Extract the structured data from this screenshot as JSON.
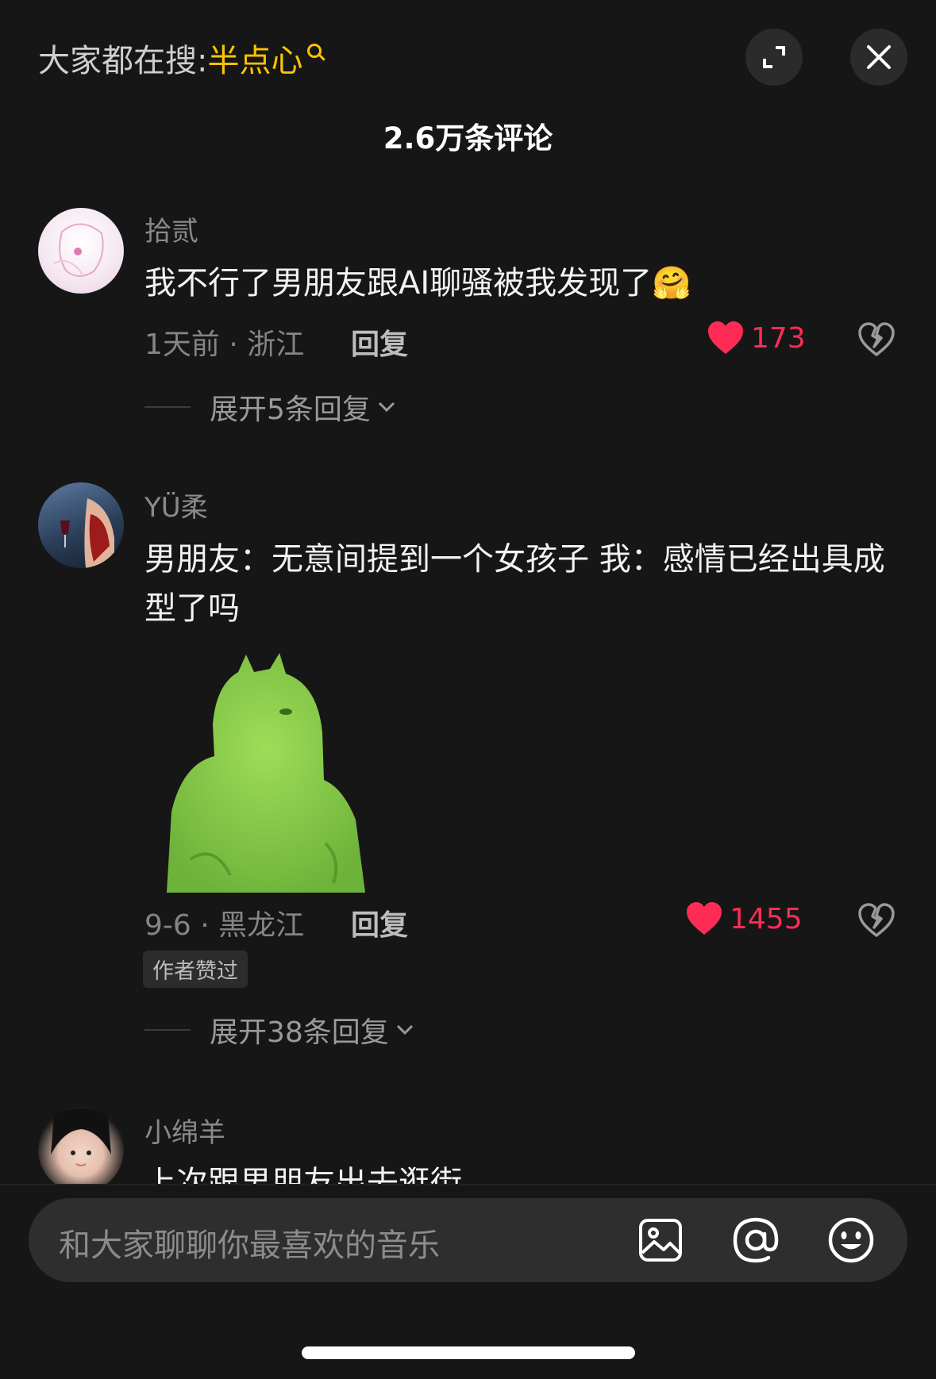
{
  "header": {
    "search_prefix": "大家都在搜:",
    "search_keyword": "半点心",
    "comment_count": "2.6万条评论"
  },
  "comments": [
    {
      "username": "拾贰",
      "text": "我不行了男朋友跟AI聊骚被我发现了🤗",
      "meta": "1天前 · 浙江",
      "reply_label": "回复",
      "likes": "173",
      "expand_label": "展开5条回复"
    },
    {
      "username": "YÜ柔",
      "text": "男朋友：无意间提到一个女孩子  我：感情已经出具成型了吗",
      "meta": "9-6 · 黑龙江",
      "reply_label": "回复",
      "likes": "1455",
      "badge": "作者赞过",
      "expand_label": "展开38条回复"
    },
    {
      "username": "小绵羊",
      "text": "上次跟男朋友出去逛街"
    }
  ],
  "input": {
    "placeholder": "和大家聊聊你最喜欢的音乐"
  },
  "icons": {
    "expand": "expand-icon",
    "close": "close-icon",
    "like": "heart-icon",
    "dislike": "broken-heart-icon",
    "image": "image-icon",
    "mention": "at-icon",
    "emoji": "emoji-icon"
  },
  "colors": {
    "background": "#161616",
    "accent": "#fe2c55",
    "keyword": "#ffc300"
  }
}
